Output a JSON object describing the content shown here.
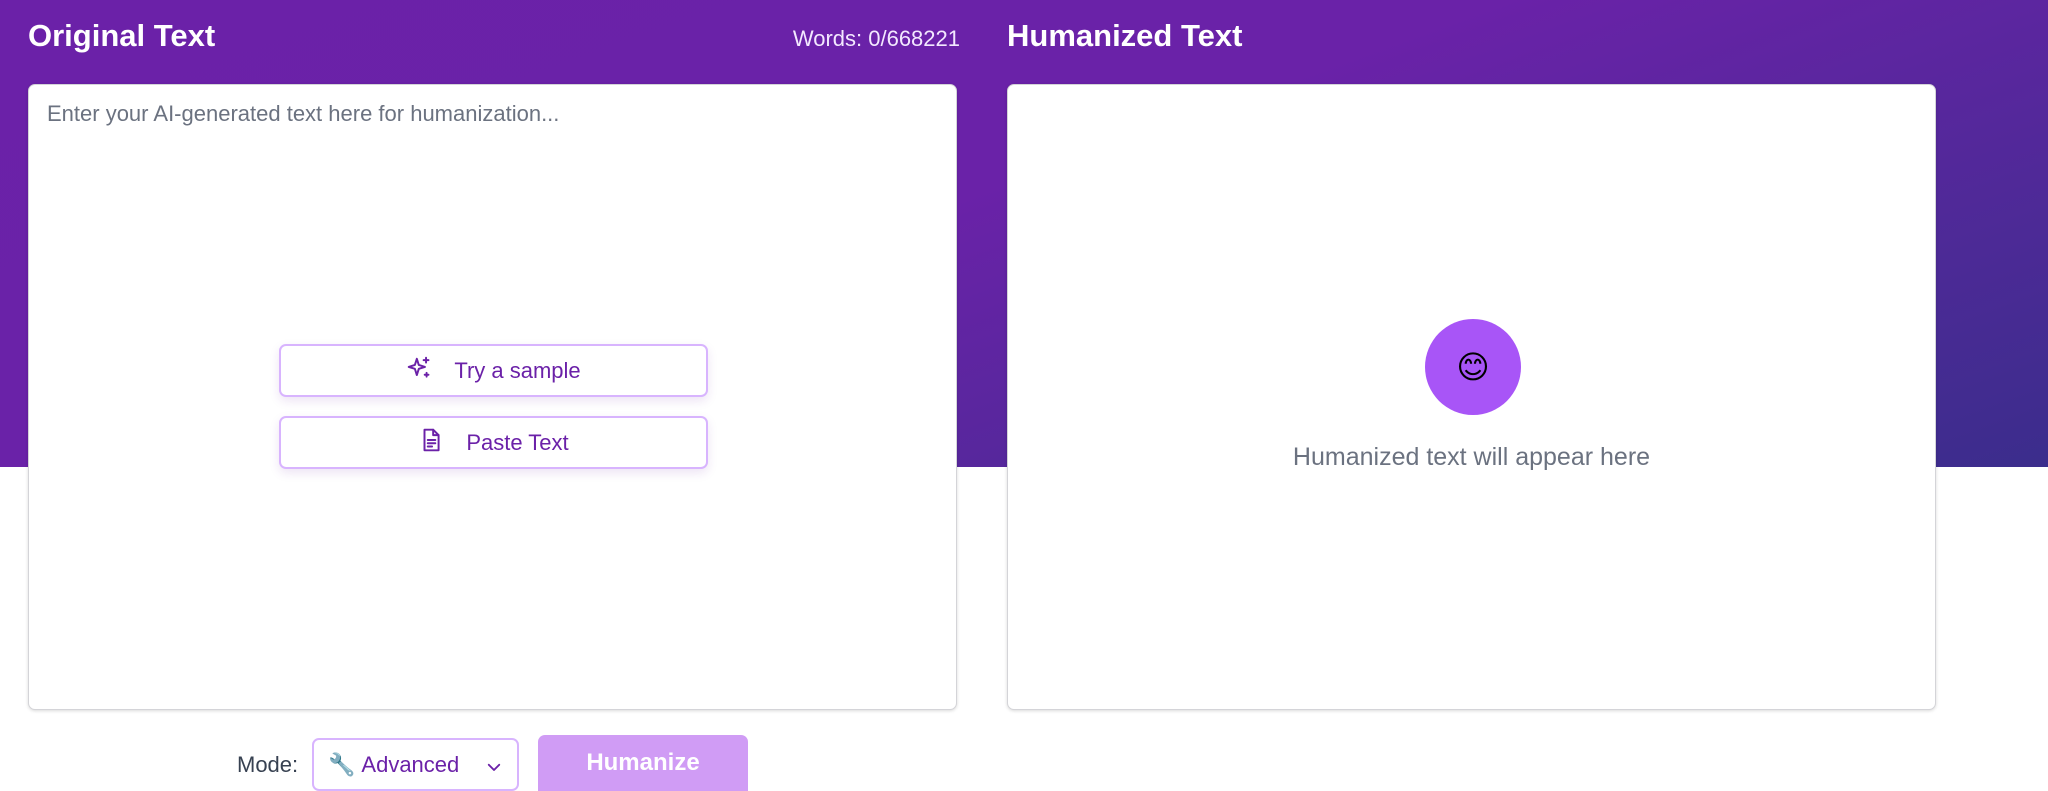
{
  "original": {
    "title": "Original Text",
    "word_count": "Words: 0/668221",
    "placeholder": "Enter your AI-generated text here for humanization...",
    "sample_button": "Try a sample",
    "paste_button": "Paste Text"
  },
  "humanized": {
    "title": "Humanized Text",
    "icon": "😊",
    "empty_message": "Humanized text will appear here"
  },
  "controls": {
    "mode_label": "Mode:",
    "mode_icon": "🔧",
    "mode_value": "Advanced",
    "humanize_button": "Humanize"
  },
  "colors": {
    "brand_purple": "#6b21a8",
    "accent_purple": "#a855f7",
    "button_disabled": "#d09cf5"
  }
}
